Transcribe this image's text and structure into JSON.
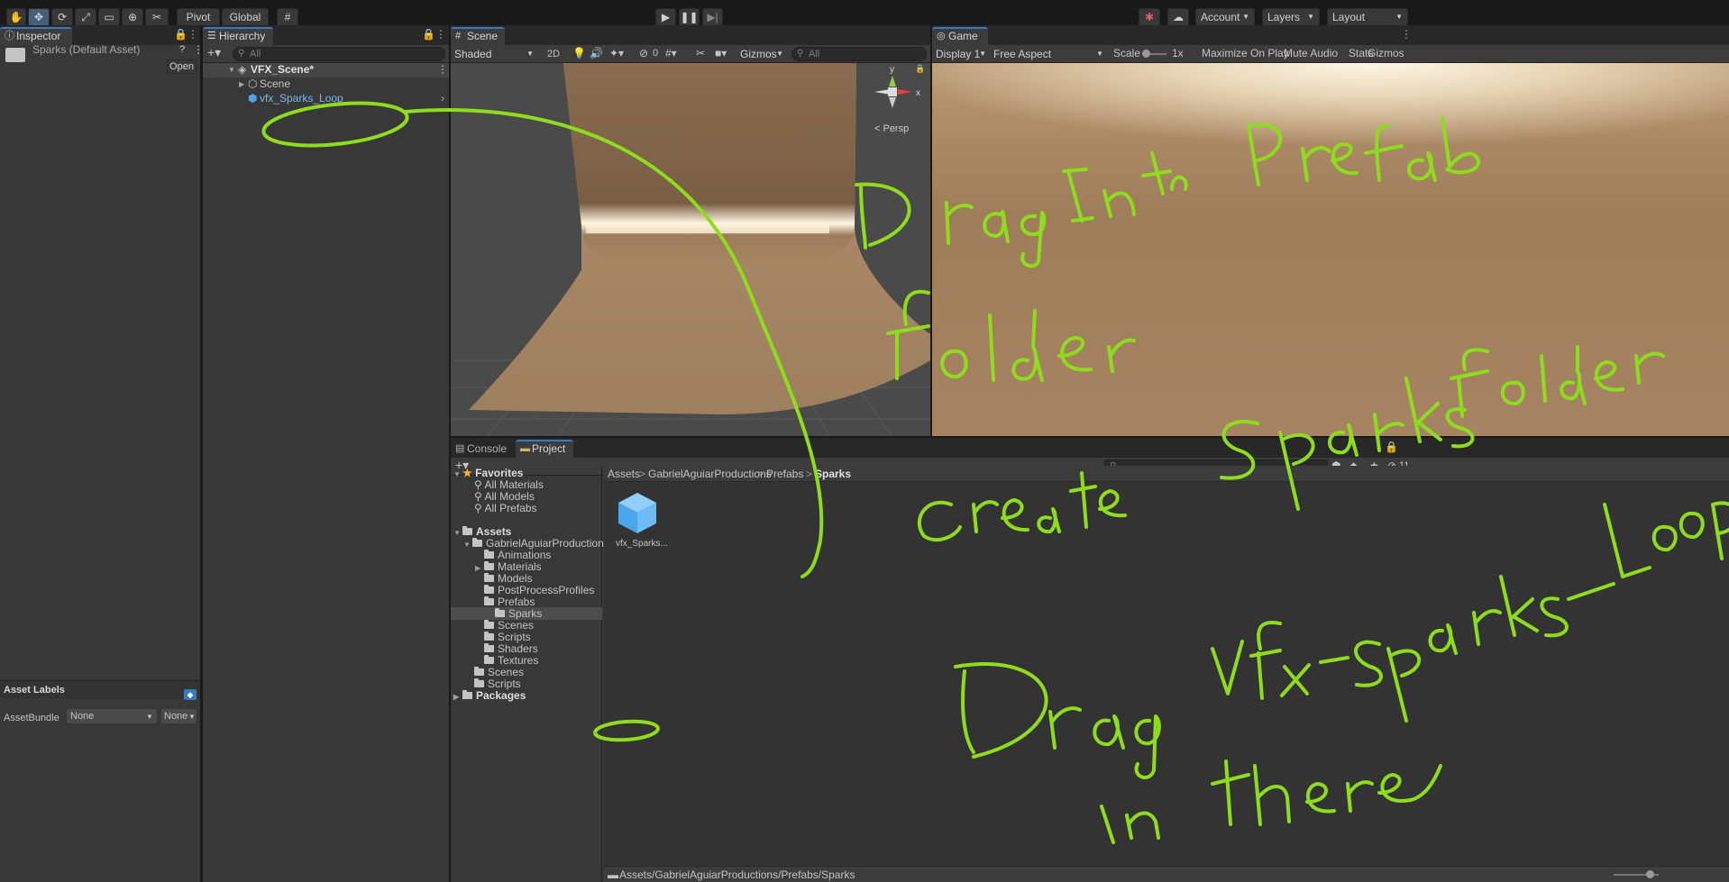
{
  "toolbar": {
    "pivot": "Pivot",
    "global": "Global",
    "account": "Account",
    "layers": "Layers",
    "layout": "Layout"
  },
  "inspector": {
    "tab": "Inspector",
    "asset_title": "Sparks (Default Asset)",
    "open_button": "Open",
    "asset_labels": "Asset Labels",
    "assetbundle_label": "AssetBundle",
    "assetbundle_value": "None",
    "variant_value": "None"
  },
  "hierarchy": {
    "tab": "Hierarchy",
    "search_placeholder": "All",
    "scene_root": "VFX_Scene*",
    "items": [
      "Scene",
      "vfx_Sparks_Loop"
    ]
  },
  "scene_view": {
    "tab": "Scene",
    "shading": "Shaded",
    "mode_2d": "2D",
    "hidden_count": "0",
    "gizmos": "Gizmos",
    "search_placeholder": "All",
    "persp": "< Persp",
    "axis_y": "y",
    "axis_x": "x"
  },
  "game_view": {
    "tab": "Game",
    "display": "Display 1",
    "aspect": "Free Aspect",
    "scale_label": "Scale",
    "scale_value": "1x",
    "maximize": "Maximize On Play",
    "mute": "Mute Audio",
    "stats": "Stats",
    "gizmos": "Gizmos"
  },
  "bottom": {
    "tabs": [
      "Console",
      "Project"
    ],
    "hidden_count": "11",
    "breadcrumb": [
      "Assets",
      "GabrielAguiarProductions",
      "Prefabs",
      "Sparks"
    ],
    "status_path": "Assets/GabrielAguiarProductions/Prefabs/Sparks",
    "asset_item": "vfx_Sparks..."
  },
  "project_tree": {
    "favorites": "Favorites",
    "favorite_items": [
      "All Materials",
      "All Models",
      "All Prefabs"
    ],
    "assets": "Assets",
    "company": "GabrielAguiarProductions",
    "company_children": [
      "Animations",
      "Materials",
      "Models",
      "PostProcessProfiles",
      "Prefabs"
    ],
    "prefab_child": "Sparks",
    "company_tail": [
      "Scenes",
      "Scripts",
      "Shaders",
      "Textures"
    ],
    "assets_tail": [
      "Scenes",
      "Scripts"
    ],
    "packages": "Packages"
  },
  "annotation": {
    "color": "#8ddc1d"
  }
}
